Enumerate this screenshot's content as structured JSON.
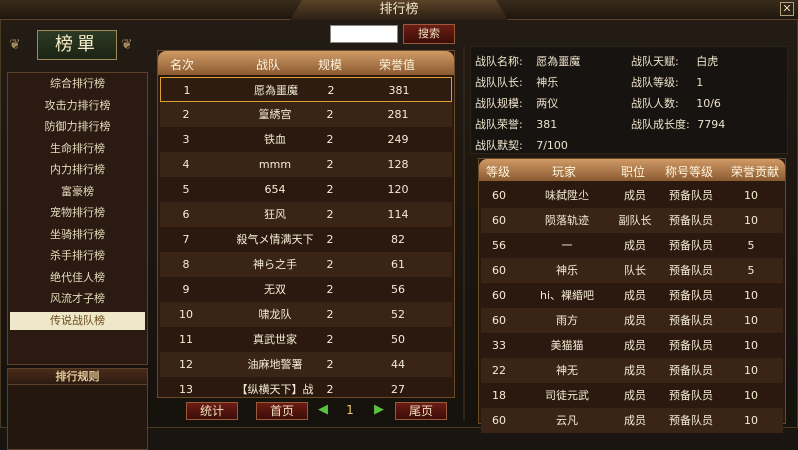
{
  "window": {
    "title": "排行榜",
    "close_glyph": "✕"
  },
  "search": {
    "value": "",
    "button_label": "搜索"
  },
  "sidebar": {
    "title": "榜單",
    "items": [
      {
        "label": "综合排行榜"
      },
      {
        "label": "攻击力排行榜"
      },
      {
        "label": "防御力排行榜"
      },
      {
        "label": "生命排行榜"
      },
      {
        "label": "内力排行榜"
      },
      {
        "label": "富豪榜"
      },
      {
        "label": "宠物排行榜"
      },
      {
        "label": "坐骑排行榜"
      },
      {
        "label": "杀手排行榜"
      },
      {
        "label": "绝代佳人榜"
      },
      {
        "label": "风流才子榜"
      },
      {
        "label": "传说战队榜"
      }
    ],
    "active_index": 11,
    "rules_label": "排行规则"
  },
  "ranking": {
    "columns": [
      "名次",
      "战队",
      "规模",
      "荣誉值"
    ],
    "rows": [
      {
        "rank": "1",
        "team": "愿為噩魔",
        "size": "2",
        "honor": "381"
      },
      {
        "rank": "2",
        "team": "篁綉宫",
        "size": "2",
        "honor": "281"
      },
      {
        "rank": "3",
        "team": "铁血",
        "size": "2",
        "honor": "249"
      },
      {
        "rank": "4",
        "team": "mmm",
        "size": "2",
        "honor": "128"
      },
      {
        "rank": "5",
        "team": "654",
        "size": "2",
        "honor": "120"
      },
      {
        "rank": "6",
        "team": "狂风",
        "size": "2",
        "honor": "114"
      },
      {
        "rank": "7",
        "team": "殺气メ情满天下",
        "size": "2",
        "honor": "82"
      },
      {
        "rank": "8",
        "team": "神ら之手",
        "size": "2",
        "honor": "61"
      },
      {
        "rank": "9",
        "team": "无双",
        "size": "2",
        "honor": "56"
      },
      {
        "rank": "10",
        "team": "啸龙队",
        "size": "2",
        "honor": "52"
      },
      {
        "rank": "11",
        "team": "真武世家",
        "size": "2",
        "honor": "50"
      },
      {
        "rank": "12",
        "team": "油麻地警署",
        "size": "2",
        "honor": "44"
      },
      {
        "rank": "13",
        "team": "【纵横天下】战",
        "size": "2",
        "honor": "27"
      }
    ],
    "selected_index": 0
  },
  "pager": {
    "stats_label": "统计",
    "first_label": "首页",
    "last_label": "尾页",
    "page": "1",
    "prev_glyph": "◀",
    "next_glyph": "▶"
  },
  "team_info": {
    "name_label": "战队名称:",
    "name_value": "愿為噩魔",
    "talent_label": "战队天赋:",
    "talent_value": "白虎",
    "leader_label": "战队队长:",
    "leader_value": "神乐",
    "level_label": "战队等级:",
    "level_value": "1",
    "scale_label": "战队规模:",
    "scale_value": "两仪",
    "count_label": "战队人数:",
    "count_value": "10/6",
    "honor_label": "战队荣誉:",
    "honor_value": "381",
    "growth_label": "战队成长度:",
    "growth_value": "7794",
    "bond_label": "战队默契:",
    "bond_value": "7/100"
  },
  "members": {
    "columns": [
      "等级",
      "玩家",
      "职位",
      "称号等级",
      "荣誉贡献"
    ],
    "rows": [
      {
        "level": "60",
        "player": "味弑陞尐",
        "position": "成员",
        "title": "预备队员",
        "contrib": "10"
      },
      {
        "level": "60",
        "player": "陨落轨迹",
        "position": "副队长",
        "title": "预备队员",
        "contrib": "10"
      },
      {
        "level": "56",
        "player": "一",
        "position": "成员",
        "title": "预备队员",
        "contrib": "5"
      },
      {
        "level": "60",
        "player": "神乐",
        "position": "队长",
        "title": "预备队员",
        "contrib": "5"
      },
      {
        "level": "60",
        "player": "hi、裸緍吧",
        "position": "成员",
        "title": "预备队员",
        "contrib": "10"
      },
      {
        "level": "60",
        "player": "雨方",
        "position": "成员",
        "title": "预备队员",
        "contrib": "10"
      },
      {
        "level": "33",
        "player": "美猫猫",
        "position": "成员",
        "title": "预备队员",
        "contrib": "10"
      },
      {
        "level": "22",
        "player": "神无",
        "position": "成员",
        "title": "预备队员",
        "contrib": "10"
      },
      {
        "level": "18",
        "player": "司徒元武",
        "position": "成员",
        "title": "预备队员",
        "contrib": "10"
      },
      {
        "level": "60",
        "player": "云凡",
        "position": "成员",
        "title": "预备队员",
        "contrib": "10"
      }
    ]
  }
}
